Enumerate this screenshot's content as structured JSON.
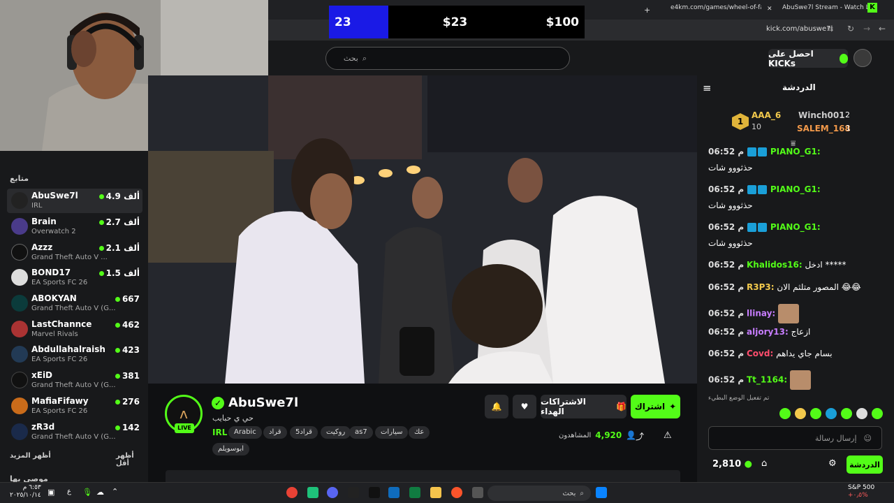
{
  "browser": {
    "tabs": [
      {
        "label": "e4km.com/games/wheel-of-fan"
      },
      {
        "label": "AbuSwe7l Stream - Watch L"
      }
    ],
    "new_tab": "+",
    "url": "kick.com/abuswe7l"
  },
  "wheel": {
    "left": "23",
    "middle": "$23",
    "right": "$100"
  },
  "header": {
    "search_placeholder": "بحث",
    "get_kicks": "احصل على KICKs"
  },
  "sidebar": {
    "title": "متابع",
    "channels": [
      {
        "name": "AbuSwe7l",
        "game": "IRL",
        "viewers": "4.9 ألف",
        "active": true
      },
      {
        "name": "Brain",
        "game": "Overwatch 2",
        "viewers": "2.7 ألف"
      },
      {
        "name": "Azzz",
        "game": "Grand Theft Auto V ...",
        "viewers": "2.1 ألف"
      },
      {
        "name": "BOND17",
        "game": "EA Sports FC 26",
        "viewers": "1.5 ألف"
      },
      {
        "name": "ABOKYAN",
        "game": "Grand Theft Auto V (G...",
        "viewers": "667"
      },
      {
        "name": "LastChannce",
        "game": "Marvel Rivals",
        "viewers": "462"
      },
      {
        "name": "Abdullahalraish",
        "game": "EA Sports FC 26",
        "viewers": "423"
      },
      {
        "name": "xEiD",
        "game": "Grand Theft Auto V (G...",
        "viewers": "381"
      },
      {
        "name": "MafiaFifawy",
        "game": "EA Sports FC 26",
        "viewers": "276"
      },
      {
        "name": "zR3d",
        "game": "Grand Theft Auto V (G...",
        "viewers": "142"
      }
    ],
    "show_more": "أظهر المزيد",
    "show_less": "أظهر أقل",
    "recommended": "موصى بها"
  },
  "stream": {
    "channel_name": "AbuSwe7l",
    "live_badge": "LIVE",
    "title": "حي ي حبايب",
    "category": "IRL",
    "tags": [
      "Arabic",
      "قراد",
      "قراد5",
      "روكيت",
      "as7",
      "سيارات",
      "عك",
      "ابوسويلم"
    ],
    "subscribe": "اشتراك",
    "gift_subs": "الاشتراكات الهداء",
    "viewers_label": "المشاهدون",
    "viewers_count": "4,920"
  },
  "chat": {
    "title": "الدردشة",
    "leaderboard": {
      "first": {
        "rank": "1",
        "name": "AAA_6",
        "count": "10"
      },
      "second": {
        "name": "Winch001",
        "count": "2"
      },
      "third": {
        "name": "SALEM_168",
        "count": "1"
      }
    },
    "messages": [
      {
        "time": "06:52 م",
        "user": "PIANO_G1:",
        "text": "حذثووو شات",
        "color": "#53fc18"
      },
      {
        "time": "06:52 م",
        "user": "PIANO_G1:",
        "text": "حذثووو شات",
        "color": "#53fc18"
      },
      {
        "time": "06:52 م",
        "user": "PIANO_G1:",
        "text": "حذثووو شات",
        "color": "#53fc18"
      },
      {
        "time": "06:52 م",
        "user": "Khalidos16:",
        "text": "ادخل *****",
        "color": "#53fc18"
      },
      {
        "time": "06:52 م",
        "user": "R3P3:",
        "text": "المصور متلثم الان 😂😂",
        "color": "#f2c94c"
      },
      {
        "time": "06:52 م",
        "user": "llinay:",
        "text": "",
        "color": "#c77dff"
      },
      {
        "time": "06:52 م",
        "user": "aljory13:",
        "text": "ازعاج",
        "color": "#c77dff"
      },
      {
        "time": "06:52 م",
        "user": "Covd:",
        "text": "بسام جاي يداهم",
        "color": "#ff4d6d"
      },
      {
        "time": "06:52 م",
        "user": "Tt_1164:",
        "text": "",
        "color": "#53fc18"
      }
    ],
    "slow_mode": "تم تفعيل الوضع البطيء",
    "input_placeholder": "إرسال رسالة",
    "send": "الدردشة",
    "points": "2,810"
  },
  "taskbar": {
    "search": "بحث",
    "sp500": "S&P 500",
    "sp500_change": "+٠٫٥%",
    "time": "٦:٥٣ م",
    "date": "٢٠٢٥/١٠/١٤",
    "lang": "ع"
  }
}
